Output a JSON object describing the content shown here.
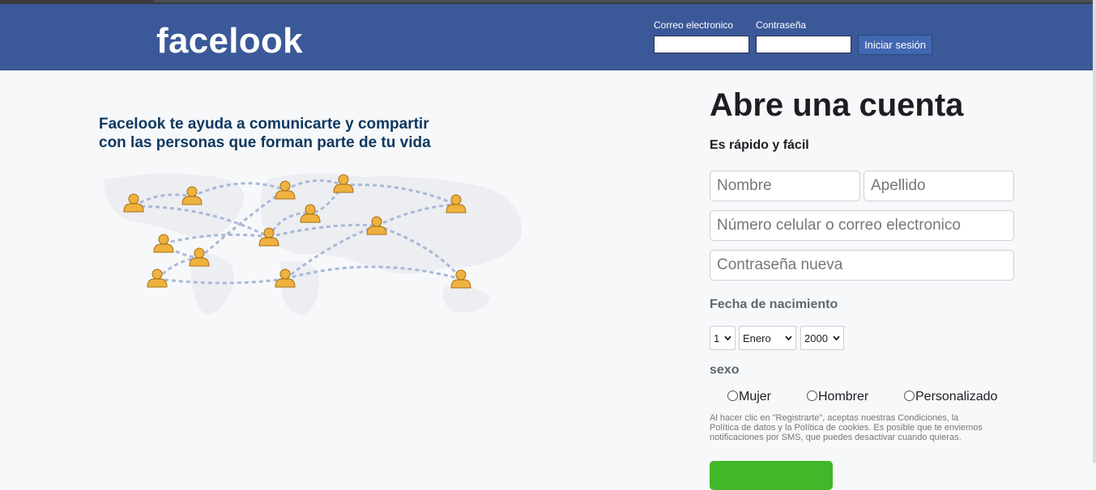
{
  "header": {
    "logo": "facelook",
    "email_label": "Correo electronico",
    "password_label": "Contraseña",
    "login_button": "Iniciar sesión"
  },
  "left": {
    "tagline_line1": "Facelook te ayuda a comunicarte y compartir",
    "tagline_line2": "con las personas que forman parte de tu vida",
    "map_icon": "people-network-icon"
  },
  "signup": {
    "title": "Abre una cuenta",
    "subtitle": "Es rápido y fácil",
    "first_name_placeholder": "Nombre",
    "last_name_placeholder": "Apellido",
    "contact_placeholder": "Número celular o correo electronico",
    "password_placeholder": "Contraseña nueva",
    "birthday_label": "Fecha de nacimiento",
    "day_value": "1",
    "month_value": "Enero",
    "year_value": "2000",
    "gender_label": "sexo",
    "gender_options": [
      "Mujer",
      "Hombrer",
      "Personalizado"
    ],
    "terms_line1": "Al hacer clic en \"Registrarte\", aceptas nuestras Condiciones, la",
    "terms_line2": "Política de datos y la Política de cookies. Es posible que te enviemos",
    "terms_line3": "notificaciones por SMS, que puedes desactivar cuando quieras."
  },
  "colors": {
    "header_bg": "#3b5998",
    "tagline": "#0e385f",
    "person_icon": "#f0b23e",
    "register_button": "#42b72a"
  }
}
